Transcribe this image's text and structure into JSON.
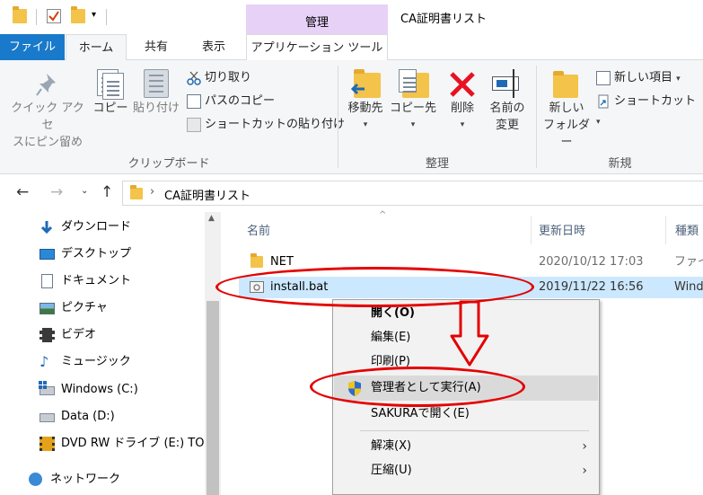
{
  "window": {
    "title": "CA証明書リスト",
    "context_tab_group": "管理"
  },
  "tabs": [
    {
      "label": "ファイル"
    },
    {
      "label": "ホーム"
    },
    {
      "label": "共有"
    },
    {
      "label": "表示"
    },
    {
      "label": "アプリケーション ツール"
    }
  ],
  "ribbon": {
    "clipboard": {
      "pin_line1": "クイック アクセ",
      "pin_line2": "スにピン留め",
      "copy": "コピー",
      "paste": "貼り付け",
      "cut": "切り取り",
      "copy_path": "パスのコピー",
      "paste_shortcut": "ショートカットの貼り付け",
      "group_label": "クリップボード"
    },
    "organize": {
      "move_to": "移動先",
      "copy_to": "コピー先",
      "delete": "削除",
      "rename_line1": "名前の",
      "rename_line2": "変更",
      "group_label": "整理"
    },
    "new": {
      "new_folder_line1": "新しい",
      "new_folder_line2": "フォルダー",
      "new_item": "新しい項目",
      "shortcut": "ショートカット",
      "group_label": "新規"
    }
  },
  "address": {
    "path": "CA証明書リスト"
  },
  "nav": [
    {
      "label": "ダウンロード",
      "icon": "download-icon"
    },
    {
      "label": "デスクトップ",
      "icon": "desktop-icon"
    },
    {
      "label": "ドキュメント",
      "icon": "documents-icon"
    },
    {
      "label": "ピクチャ",
      "icon": "pictures-icon"
    },
    {
      "label": "ビデオ",
      "icon": "video-icon"
    },
    {
      "label": "ミュージック",
      "icon": "music-icon"
    },
    {
      "label": "Windows (C:)",
      "icon": "drive-c-icon"
    },
    {
      "label": "Data (D:)",
      "icon": "drive-d-icon"
    },
    {
      "label": "DVD RW ドライブ (E:) TOi",
      "icon": "dvd-drive-icon"
    },
    {
      "label": "ネットワーク",
      "icon": "network-icon"
    }
  ],
  "columns": {
    "name": "名前",
    "modified": "更新日時",
    "type": "種類"
  },
  "files": [
    {
      "name": "NET",
      "modified": "2020/10/12 17:03",
      "type": "ファイ",
      "icon": "folder-icon"
    },
    {
      "name": "install.bat",
      "modified": "2019/11/22 16:56",
      "type": "Wind",
      "icon": "batch-file-icon"
    }
  ],
  "context_menu": {
    "open": "開く(O)",
    "edit": "編集(E)",
    "print": "印刷(P)",
    "run_as_admin": "管理者として実行(A)",
    "open_sakura": "SAKURAで開く(E)",
    "extract": "解凍(X)",
    "compress": "圧縮(U)"
  },
  "colors": {
    "file_tab": "#1979ca",
    "manage_tab": "#e8d1f7",
    "selection": "#cce8ff",
    "annotation": "#e50000"
  }
}
